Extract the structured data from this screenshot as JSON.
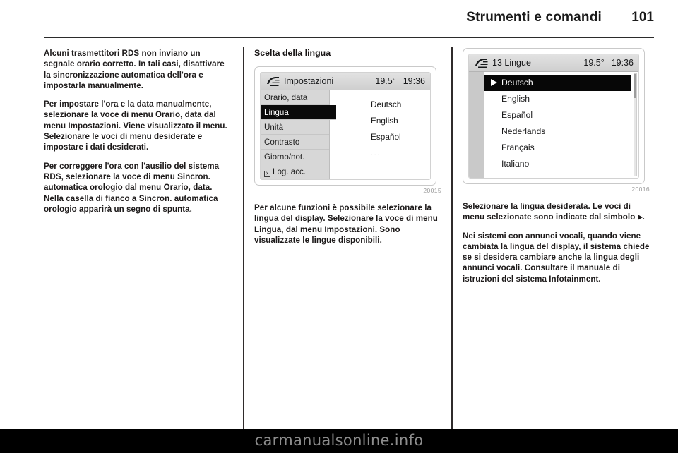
{
  "header": {
    "title": "Strumenti e comandi",
    "page_number": "101"
  },
  "columns": {
    "left": {
      "paragraphs": [
        "Alcuni trasmettitori RDS non inviano un segnale orario corretto. In tali casi, disattivare la sincronizzazione automatica dell'ora e impostarla manualmente.",
        "Per impostare l'ora e la data manualmente, selezionare la voce di menu Orario, data dal menu Impostazioni. Viene visualizzato il menu. Selezionare le voci di menu desiderate e impostare i dati desiderati.",
        "Per correggere l'ora con l'ausilio del sistema RDS, selezionare la voce di menu Sincron. automatica orologio dal menu Orario, data. Nella casella di fianco a Sincron. automatica orologio apparirà un segno di spunta."
      ]
    },
    "middle": {
      "heading": "Scelta della lingua",
      "figure_caption": "20015",
      "paragraphs": [
        "Per alcune funzioni è possibile selezionare la lingua del display. Selezionare la voce di menu Lingua, dal menu Impostazioni. Sono visualizzate le lingue disponibili."
      ]
    },
    "right": {
      "figure_caption": "20016",
      "paragraph_1_before_symbol": "Selezionare la lingua desiderata. Le voci di menu selezionate sono indicate dal simbolo ",
      "paragraph_1_after_symbol": ".",
      "paragraphs": [
        "Nei sistemi con annunci vocali, quando viene cambiata la lingua del display, il sistema chiede se si desidera cambiare anche la lingua degli annunci vocali. Consultare il manuale di istruzioni del sistema Infotainment."
      ]
    }
  },
  "settings_screen": {
    "icon": "car-settings-icon",
    "title": "Impostazioni",
    "temperature": "19.5°",
    "clock": "19:36",
    "menu_items": [
      {
        "label": "Orario, data",
        "selected": false,
        "checkbox": false
      },
      {
        "label": "Lingua",
        "selected": true,
        "checkbox": false
      },
      {
        "label": "Unità",
        "selected": false,
        "checkbox": false
      },
      {
        "label": "Contrasto",
        "selected": false,
        "checkbox": false
      },
      {
        "label": "Giorno/not.",
        "selected": false,
        "checkbox": false
      },
      {
        "label": "Log. acc.",
        "selected": false,
        "checkbox": true
      }
    ],
    "options": [
      "Deutsch",
      "English",
      "Español",
      "..."
    ]
  },
  "language_screen": {
    "icon": "car-settings-icon",
    "title": "13 Lingue",
    "temperature": "19.5°",
    "clock": "19:36",
    "items": [
      {
        "label": "Deutsch",
        "selected": true
      },
      {
        "label": "English",
        "selected": false
      },
      {
        "label": "Español",
        "selected": false
      },
      {
        "label": "Nederlands",
        "selected": false
      },
      {
        "label": "Français",
        "selected": false
      },
      {
        "label": "Italiano",
        "selected": false
      }
    ]
  },
  "watermark": "carmanualsonline.info",
  "colors": {
    "page_background": "#ffffff",
    "text": "#1d1a1a",
    "selection": "#0a0a0a",
    "screen_chrome": "#d7d7d7",
    "caption": "#9a9a9a",
    "band": "#000000"
  }
}
